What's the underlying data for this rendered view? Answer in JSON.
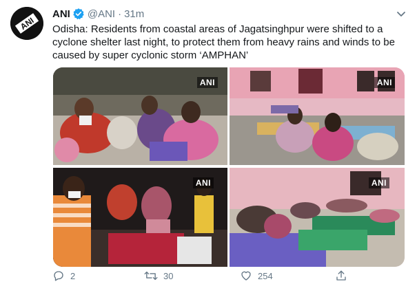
{
  "tweet": {
    "author": {
      "name": "ANI",
      "handle": "@ANI",
      "time": "31m",
      "avatar_text": "ANI"
    },
    "text": "Odisha: Residents from coastal areas of Jagatsinghpur were shifted to a cyclone shelter last night, to protect them from heavy rains and winds to be caused by super cyclonic storm ‘AMPHAN’",
    "photos": [
      {
        "watermark": "ANI",
        "scene": "people seated on mats"
      },
      {
        "watermark": "ANI",
        "scene": "pink room with people resting"
      },
      {
        "watermark": "ANI",
        "scene": "people at night with bags"
      },
      {
        "watermark": "ANI",
        "scene": "people lying on mats near wall"
      }
    ],
    "actions": {
      "reply_count": "2",
      "retweet_count": "30",
      "like_count": "254",
      "share_count": ""
    }
  },
  "colors": {
    "verified": "#1da1f2",
    "text_secondary": "#657786",
    "text_primary": "#14171a"
  }
}
